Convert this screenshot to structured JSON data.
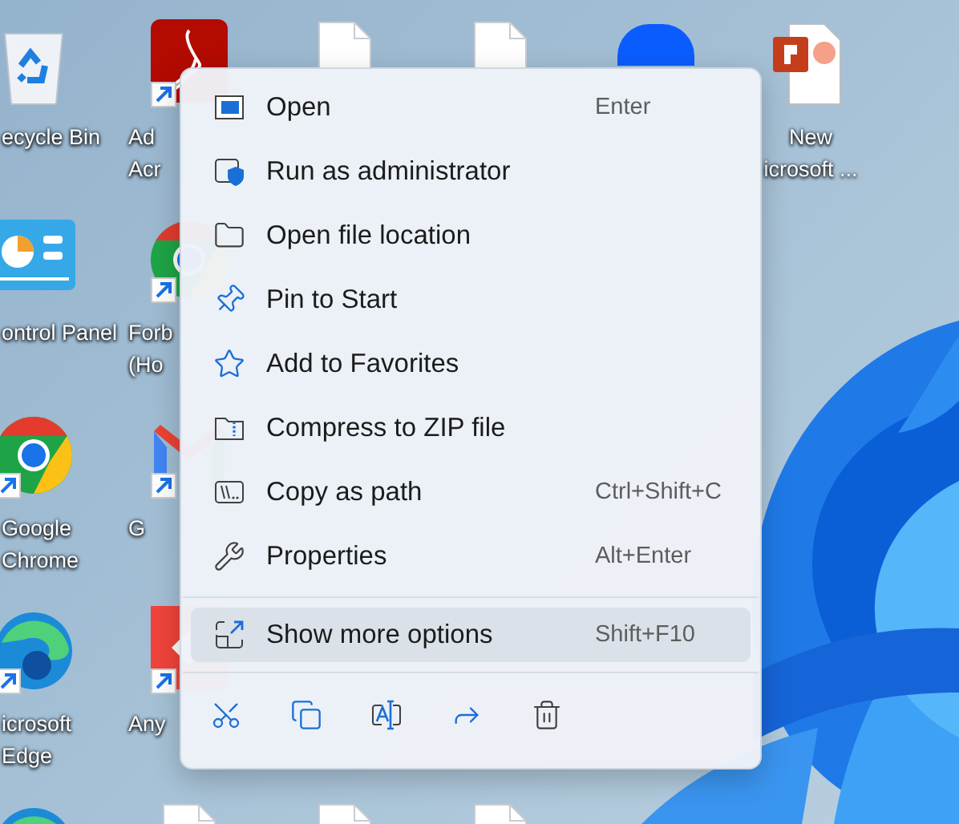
{
  "desktop_icons": [
    {
      "kind": "recycle",
      "shortcut": false,
      "label": [
        "ecycle Bin"
      ]
    },
    {
      "kind": "pdf",
      "shortcut": true,
      "label": [
        "Ad",
        "Acr"
      ]
    },
    {
      "kind": "document",
      "shortcut": false
    },
    {
      "kind": "document",
      "shortcut": false
    },
    {
      "kind": "video",
      "shortcut": false
    },
    {
      "kind": "slides",
      "shortcut": false,
      "label": [
        "New",
        "icrosoft ..."
      ]
    },
    {
      "kind": "control",
      "shortcut": false,
      "label": [
        "ontrol Panel"
      ]
    },
    {
      "kind": "browser",
      "shortcut": true,
      "label": [
        "Forb",
        "(Ho"
      ]
    },
    {
      "kind": "browser",
      "shortcut": true,
      "label": [
        "Google",
        "Chrome"
      ]
    },
    {
      "kind": "mail",
      "shortcut": true,
      "label": [
        "G"
      ]
    },
    {
      "kind": "edge",
      "shortcut": true,
      "label": [
        "icrosoft",
        "Edge"
      ]
    },
    {
      "kind": "remote",
      "shortcut": true,
      "label": [
        "Any"
      ]
    },
    {
      "kind": "edge"
    },
    {
      "kind": "document"
    },
    {
      "kind": "document"
    },
    {
      "kind": "document"
    }
  ],
  "context_menu": {
    "sections": [
      [
        {
          "kind": "open",
          "label": "Open",
          "shortcut": "Enter",
          "highlighted": false
        },
        {
          "kind": "admin",
          "label": "Run as administrator",
          "highlighted": false
        },
        {
          "kind": "folder",
          "label": "Open file location",
          "highlighted": false
        },
        {
          "kind": "pin",
          "label": "Pin to Start",
          "highlighted": false
        },
        {
          "kind": "star",
          "label": "Add to Favorites",
          "highlighted": false
        },
        {
          "kind": "zip",
          "label": "Compress to ZIP file",
          "highlighted": false
        },
        {
          "kind": "path",
          "label": "Copy as path",
          "shortcut": "Ctrl+Shift+C",
          "highlighted": false
        },
        {
          "kind": "properties",
          "label": "Properties",
          "shortcut": "Alt+Enter",
          "highlighted": false
        }
      ],
      [
        {
          "kind": "more",
          "label": "Show more options",
          "shortcut": "Shift+F10",
          "highlighted": true
        }
      ]
    ],
    "quick_actions": [
      {
        "kind": "cut"
      },
      {
        "kind": "copy"
      },
      {
        "kind": "rename"
      },
      {
        "kind": "share"
      },
      {
        "kind": "delete"
      }
    ]
  }
}
